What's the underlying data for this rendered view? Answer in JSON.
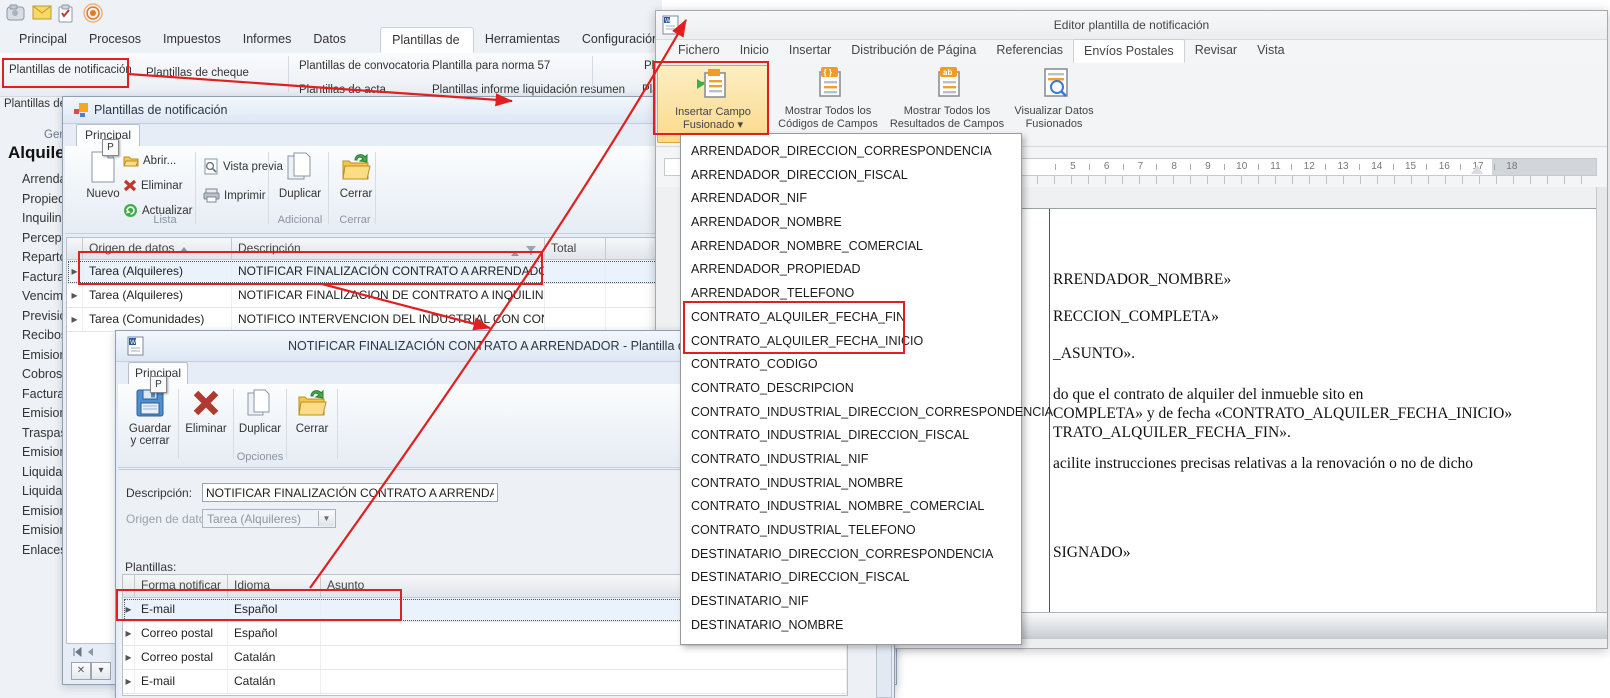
{
  "app": {
    "quick_access_icons": [
      "app-icon",
      "mail-icon",
      "clipboard-icon",
      "broadcast-icon"
    ],
    "tabs": [
      {
        "label": "Principal"
      },
      {
        "label": "Procesos"
      },
      {
        "label": "Impuestos"
      },
      {
        "label": "Informes"
      },
      {
        "label": "Datos básicos"
      },
      {
        "label": "Plantillas de texto",
        "active": true
      },
      {
        "label": "Herramientas"
      },
      {
        "label": "Configuración"
      }
    ],
    "ribbon": {
      "plantillas_notificacion": "Plantillas de notificación",
      "plantillas_cheque": "Plantillas de cheque",
      "plantillas_convocatoria": "Plantillas de convocatoria",
      "plantillas_acta": "Plantillas de acta",
      "plantilla_norma57": "Plantilla para norma 57",
      "plantillas_informe_liq": "Plantillas informe liquidación resumen",
      "planti_cut_1": "Planti",
      "planti_cut_2": "Planti",
      "plantillas_de_cut": "Plantillas de",
      "gene_cut": "Gene"
    },
    "sidebar": {
      "header": "Alquile",
      "items": [
        "Arrendad",
        "Propieda",
        "Inquilinos",
        "Percepto",
        "Repartos",
        "Facturas",
        "Vencimie",
        "Prevision",
        "Recibos",
        "Emisione",
        "Cobros a",
        "Facturas",
        "Emisione",
        "Traspaso",
        "Emisione",
        "Liquidaci",
        "Liquidaci",
        "Emisione",
        "Emisione",
        "Enlaces ("
      ]
    }
  },
  "win1": {
    "title": "Plantillas de notificación",
    "tab": "Principal",
    "keytip": "P",
    "toolbar": {
      "nuevo": "Nuevo",
      "abrir": "Abrir...",
      "eliminar": "Eliminar",
      "actualizar": "Actualizar",
      "vista_previa": "Vista previa",
      "imprimir": "Imprimir",
      "duplicar": "Duplicar",
      "cerrar": "Cerrar",
      "group_lista": "Lista",
      "group_adicional": "Adicional",
      "group_cerrar": "Cerrar"
    },
    "grid": {
      "col_origen": "Origen de datos",
      "col_descripcion": "Descripción",
      "col_total": "Total",
      "rows": [
        {
          "origen": "Tarea (Alquileres)",
          "descripcion": "NOTIFICAR FINALIZACIÓN CONTRATO A ARRENDADOR",
          "selected": true
        },
        {
          "origen": "Tarea (Alquileres)",
          "descripcion": "NOTIFICAR FINALIZACION DE CONTRATO A INQUILINO"
        },
        {
          "origen": "Tarea (Comunidades)",
          "descripcion": "NOTIFICO INTERVENCION DEL INDUSTRIAL CON CONTRATO"
        }
      ]
    }
  },
  "detail": {
    "title": "NOTIFICAR FINALIZACIÓN CONTRATO A ARRENDADOR - Plantilla de not",
    "tab": "Principal",
    "keytip": "P",
    "toolbar": {
      "guardar_l1": "Guardar",
      "guardar_l2": "y cerrar",
      "eliminar": "Eliminar",
      "duplicar": "Duplicar",
      "cerrar": "Cerrar",
      "group_opciones": "Opciones"
    },
    "fields": {
      "descripcion_label": "Descripción:",
      "descripcion_value": "NOTIFICAR FINALIZACIÓN CONTRATO A ARRENDADOR",
      "origen_label": "Origen de datos:",
      "origen_value": "Tarea (Alquileres)",
      "plantillas_label": "Plantillas:"
    },
    "grid": {
      "col_forma": "Forma notificar",
      "col_idioma": "Idioma",
      "col_asunto": "Asunto",
      "rows": [
        {
          "forma": "E-mail",
          "idioma": "Español",
          "asunto": "",
          "selected": true
        },
        {
          "forma": "Correo postal",
          "idioma": "Español",
          "asunto": ""
        },
        {
          "forma": "Correo postal",
          "idioma": "Catalán",
          "asunto": ""
        },
        {
          "forma": "E-mail",
          "idioma": "Catalán",
          "asunto": ""
        }
      ]
    }
  },
  "editor": {
    "title": "Editor plantilla de notificación",
    "tabs": [
      {
        "label": "Fichero"
      },
      {
        "label": "Inicio"
      },
      {
        "label": "Insertar"
      },
      {
        "label": "Distribución de Página"
      },
      {
        "label": "Referencias"
      },
      {
        "label": "Envíos Postales",
        "active": true
      },
      {
        "label": "Revisar"
      },
      {
        "label": "Vista"
      }
    ],
    "buttons": [
      {
        "line1": "Insertar Campo",
        "line2": "Fusionado ▾"
      },
      {
        "line1": "Mostrar Todos los",
        "line2": "Códigos de Campos"
      },
      {
        "line1": "Mostrar Todos los",
        "line2": "Resultados de Campos"
      },
      {
        "line1": "Visualizar Datos",
        "line2": "Fusionados"
      }
    ],
    "ruler_numbers": [
      "5",
      "6",
      "7",
      "8",
      "9",
      "10",
      "11",
      "12",
      "13",
      "14",
      "15",
      "16",
      "17",
      "18"
    ],
    "document_lines": [
      "RRENDADOR_NOMBRE»",
      "RECCION_COMPLETA»",
      "_ASUNTO».",
      "do que el contrato de alquiler del inmueble sito en",
      "COMPLETA»  y de fecha «CONTRATO_ALQUILER_FECHA_INICIO»",
      "TRATO_ALQUILER_FECHA_FIN».",
      "acilite instrucciones precisas relativas a la renovación o no de dicho",
      "SIGNADO»"
    ]
  },
  "popup": {
    "items": [
      "ARRENDADOR_DIRECCION_CORRESPONDENCIA",
      "ARRENDADOR_DIRECCION_FISCAL",
      "ARRENDADOR_NIF",
      "ARRENDADOR_NOMBRE",
      "ARRENDADOR_NOMBRE_COMERCIAL",
      "ARRENDADOR_PROPIEDAD",
      "ARRENDADOR_TELEFONO",
      "CONTRATO_ALQUILER_FECHA_FIN",
      "CONTRATO_ALQUILER_FECHA_INICIO",
      "CONTRATO_CODIGO",
      "CONTRATO_DESCRIPCION",
      "CONTRATO_INDUSTRIAL_DIRECCION_CORRESPONDENCIA",
      "CONTRATO_INDUSTRIAL_DIRECCION_FISCAL",
      "CONTRATO_INDUSTRIAL_NIF",
      "CONTRATO_INDUSTRIAL_NOMBRE",
      "CONTRATO_INDUSTRIAL_NOMBRE_COMERCIAL",
      "CONTRATO_INDUSTRIAL_TELEFONO",
      "DESTINATARIO_DIRECCION_CORRESPONDENCIA",
      "DESTINATARIO_DIRECCION_FISCAL",
      "DESTINATARIO_NIF",
      "DESTINATARIO_NOMBRE"
    ]
  },
  "annotations": {
    "color": "#e02020"
  }
}
